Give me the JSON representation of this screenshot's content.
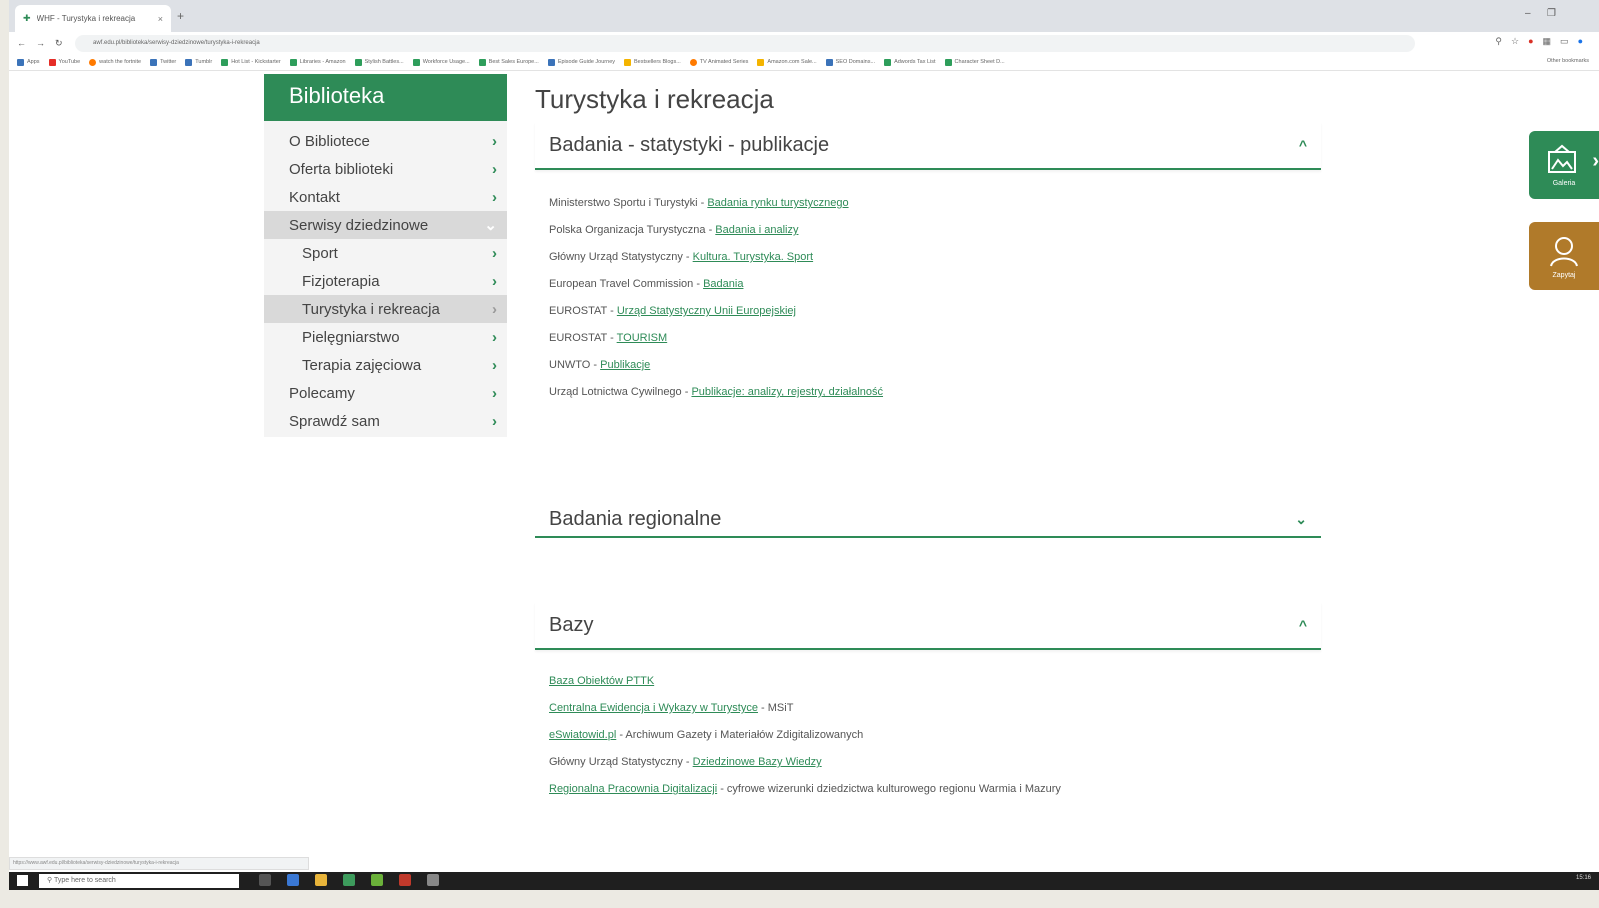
{
  "browser": {
    "tab_title": "WHF - Turystyka i rekreacja",
    "tab_close": "×",
    "new_tab": "+",
    "minimize": "–",
    "maximize": "❐",
    "url": "awf.edu.pl/biblioteka/serwisy-dziedzinowe/turystyka-i-rekreacja",
    "bookmarks": [
      "Apps",
      "YouTube",
      "watch the fortnite",
      "Twitter",
      "Tumblr",
      "Hot List - Kickstarter",
      "Libraries - Amazon",
      "Stylish Battles...",
      "Workforce Usage...",
      "Best Sales Europe...",
      "Episode Guide Journey",
      "Bestsellers Blogs...",
      "TV Animated Series",
      "Amazon.com Sale...",
      "SEO Domains...",
      "Adwords Tax List",
      "Character Sheet D..."
    ],
    "bookmarks_other": "Other bookmarks"
  },
  "sidebar": {
    "header": "Biblioteka",
    "items": [
      {
        "label": "O Bibliotece",
        "chevron": "›"
      },
      {
        "label": "Oferta biblioteki",
        "chevron": "›"
      },
      {
        "label": "Kontakt",
        "chevron": "›"
      },
      {
        "label": "Serwisy dziedzinowe",
        "chevron": "⌄"
      },
      {
        "label": "Sport",
        "chevron": "›"
      },
      {
        "label": "Fizjoterapia",
        "chevron": "›"
      },
      {
        "label": "Turystyka i rekreacja",
        "chevron": "›"
      },
      {
        "label": "Pielęgniarstwo",
        "chevron": "›"
      },
      {
        "label": "Terapia zajęciowa",
        "chevron": "›"
      },
      {
        "label": "Polecamy",
        "chevron": "›"
      },
      {
        "label": "Sprawdź sam",
        "chevron": "›"
      }
    ]
  },
  "main": {
    "title": "Turystyka i rekreacja",
    "panels": [
      {
        "title": "Badania - statystyki - publikacje",
        "toggle": "^",
        "rows": [
          {
            "prefix": "Ministerstwo Sportu i Turystyki - ",
            "link": "Badania rynku turystycznego",
            "suffix": ""
          },
          {
            "prefix": "Polska Organizacja Turystyczna - ",
            "link": "Badania i analizy",
            "suffix": ""
          },
          {
            "prefix": "Główny Urząd Statystyczny - ",
            "link": "Kultura. Turystyka. Sport",
            "suffix": ""
          },
          {
            "prefix": "European Travel Commission - ",
            "link": "Badania",
            "suffix": ""
          },
          {
            "prefix": "EUROSTAT - ",
            "link": "Urząd Statystyczny Unii Europejskiej",
            "suffix": ""
          },
          {
            "prefix": "EUROSTAT - ",
            "link": "TOURISM",
            "suffix": ""
          },
          {
            "prefix": "UNWTO - ",
            "link": "Publikacje",
            "suffix": ""
          },
          {
            "prefix": "Urząd Lotnictwa Cywilnego - ",
            "link": "Publikacje: analizy, rejestry, działalność",
            "suffix": ""
          }
        ]
      },
      {
        "title": "Badania regionalne",
        "toggle": "⌄"
      },
      {
        "title": "Bazy",
        "toggle": "^",
        "rows": [
          {
            "prefix": "",
            "link": "Baza Obiektów PTTK",
            "suffix": ""
          },
          {
            "prefix": "",
            "link": "Centralna Ewidencja i Wykazy w Turystyce",
            "suffix": " - MSiT"
          },
          {
            "prefix": "",
            "link": "eSwiatowid.pl",
            "suffix": " - Archiwum Gazety i Materiałów Zdigitalizowanych"
          },
          {
            "prefix": "Główny Urząd Statystyczny - ",
            "link": "Dziedzinowe Bazy Wiedzy",
            "suffix": ""
          },
          {
            "prefix": "",
            "link": "Regionalna Pracownia Digitalizacji",
            "suffix": " - cyfrowe wizerunki dziedzictwa kulturowego regionu Warmia i Mazury"
          }
        ]
      }
    ]
  },
  "floating": {
    "gallery_label": "Galeria",
    "contact_label": "Zapytaj",
    "gallery_arrow": "›"
  },
  "statusbar": {
    "url": "https://www.awf.edu.pl/biblioteka/serwisy-dziedzinowe/turystyka-i-rekreacja"
  },
  "taskbar": {
    "search_placeholder": "Type here to search",
    "clock": "15:16"
  },
  "colors": {
    "accent": "#2e8b57",
    "contact": "#b07a2a"
  }
}
